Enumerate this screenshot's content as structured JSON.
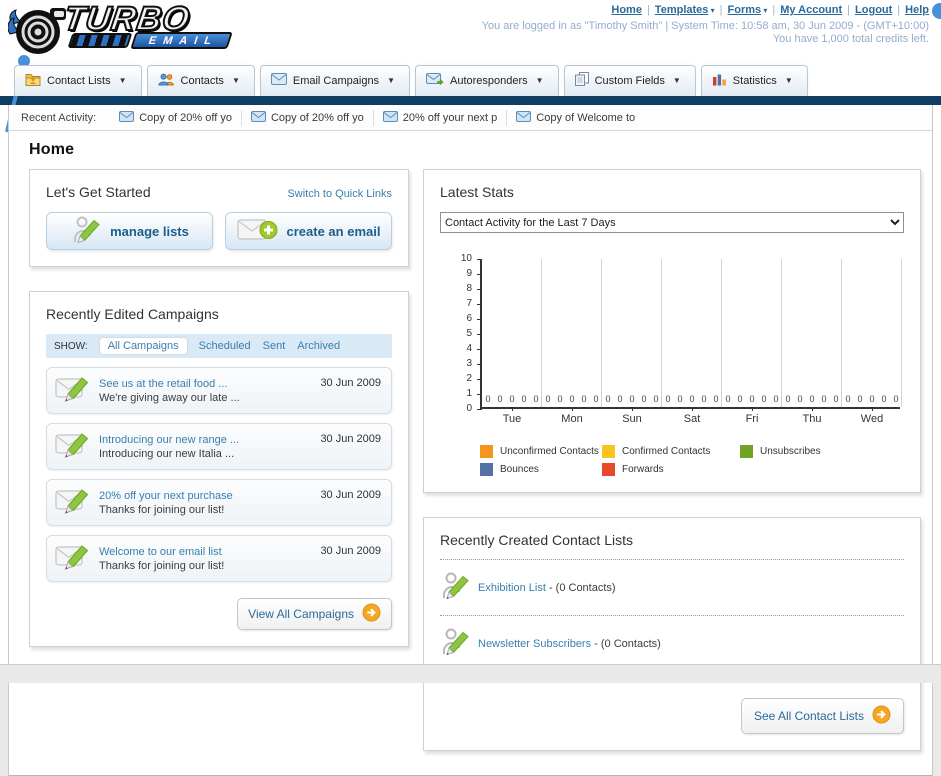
{
  "header": {
    "logo_line1": "TURBO",
    "logo_line2": "EMAIL",
    "links": [
      {
        "label": "Home",
        "menu": false
      },
      {
        "label": "Templates",
        "menu": true
      },
      {
        "label": "Forms",
        "menu": true
      },
      {
        "label": "My Account",
        "menu": false
      },
      {
        "label": "Logout",
        "menu": false
      },
      {
        "label": "Help",
        "menu": false
      }
    ],
    "login_info": "You are logged in as \"Timothy Smith\" | System Time: 10:58 am, 30 Jun 2009 - (GMT+10:00)",
    "credits": "You have 1,000 total credits left."
  },
  "nav_tabs": [
    {
      "label": "Contact Lists",
      "icon": "folder-icon"
    },
    {
      "label": "Contacts",
      "icon": "contacts-icon"
    },
    {
      "label": "Email Campaigns",
      "icon": "envelope-icon"
    },
    {
      "label": "Autoresponders",
      "icon": "autoresponder-icon"
    },
    {
      "label": "Custom Fields",
      "icon": "copy-icon"
    },
    {
      "label": "Statistics",
      "icon": "bar-chart-icon"
    }
  ],
  "recent_activity": {
    "label": "Recent Activity:",
    "items": [
      "Copy of 20% off yo",
      "Copy of 20% off yo",
      "20% off your next p",
      "Copy of Welcome to"
    ]
  },
  "main": {
    "title": "Home"
  },
  "get_started": {
    "title": "Let's Get Started",
    "switch_link": "Switch to Quick Links",
    "buttons": [
      {
        "label": "manage lists",
        "icon": "manage-lists-icon"
      },
      {
        "label": "create an email",
        "icon": "create-email-icon"
      }
    ]
  },
  "campaigns": {
    "title": "Recently Edited Campaigns",
    "filter_label": "SHOW:",
    "filters": [
      {
        "label": "All Campaigns",
        "active": true
      },
      {
        "label": "Scheduled",
        "active": false
      },
      {
        "label": "Sent",
        "active": false
      },
      {
        "label": "Archived",
        "active": false
      }
    ],
    "items": [
      {
        "title": "See us at the retail food ...",
        "subtitle": "We're giving away our late ...",
        "date": "30 Jun 2009"
      },
      {
        "title": "Introducing our new range ...",
        "subtitle": "Introducing our new Italia ...",
        "date": "30 Jun 2009"
      },
      {
        "title": "20% off your next purchase",
        "subtitle": "Thanks for joining our list!",
        "date": "30 Jun 2009"
      },
      {
        "title": "Welcome to our email list",
        "subtitle": "Thanks for joining our list!",
        "date": "30 Jun 2009"
      }
    ],
    "view_all_label": "View All Campaigns"
  },
  "latest_stats": {
    "title": "Latest Stats",
    "period_selected": "Contact Activity for the Last 7 Days"
  },
  "chart_data": {
    "type": "bar",
    "title": "Contact Activity for the Last 7 Days",
    "categories": [
      "Tue",
      "Mon",
      "Sun",
      "Sat",
      "Fri",
      "Thu",
      "Wed"
    ],
    "series": [
      {
        "name": "Unconfirmed Contacts",
        "color": "#f7941d",
        "values": [
          0,
          0,
          0,
          0,
          0,
          0,
          0
        ]
      },
      {
        "name": "Confirmed Contacts",
        "color": "#fcc21e",
        "values": [
          0,
          0,
          0,
          0,
          0,
          0,
          0
        ]
      },
      {
        "name": "Unsubscribes",
        "color": "#72a324",
        "values": [
          0,
          0,
          0,
          0,
          0,
          0,
          0
        ]
      },
      {
        "name": "Bounces",
        "color": "#5572a7",
        "values": [
          0,
          0,
          0,
          0,
          0,
          0,
          0
        ]
      },
      {
        "name": "Forwards",
        "color": "#e8492a",
        "values": [
          0,
          0,
          0,
          0,
          0,
          0,
          0
        ]
      }
    ],
    "ylim": [
      0,
      10
    ],
    "yticks": [
      0,
      1,
      2,
      3,
      4,
      5,
      6,
      7,
      8,
      9,
      10
    ],
    "grid": "vertical",
    "legend_position": "bottom",
    "xlabel": "",
    "ylabel": ""
  },
  "contact_lists": {
    "title": "Recently Created Contact Lists",
    "items": [
      {
        "name": "Exhibition List",
        "suffix": "- (0 Contacts)"
      },
      {
        "name": "Newsletter Subscribers",
        "suffix": "- (0 Contacts)"
      }
    ],
    "see_all_label": "See All Contact Lists"
  },
  "colors": {
    "navy_bar": "#0e3e63",
    "link_blue": "#2a6a9b",
    "item_link_blue": "#3a7fae",
    "accent_orange": "#f5a623",
    "login_text": "#93accc"
  }
}
